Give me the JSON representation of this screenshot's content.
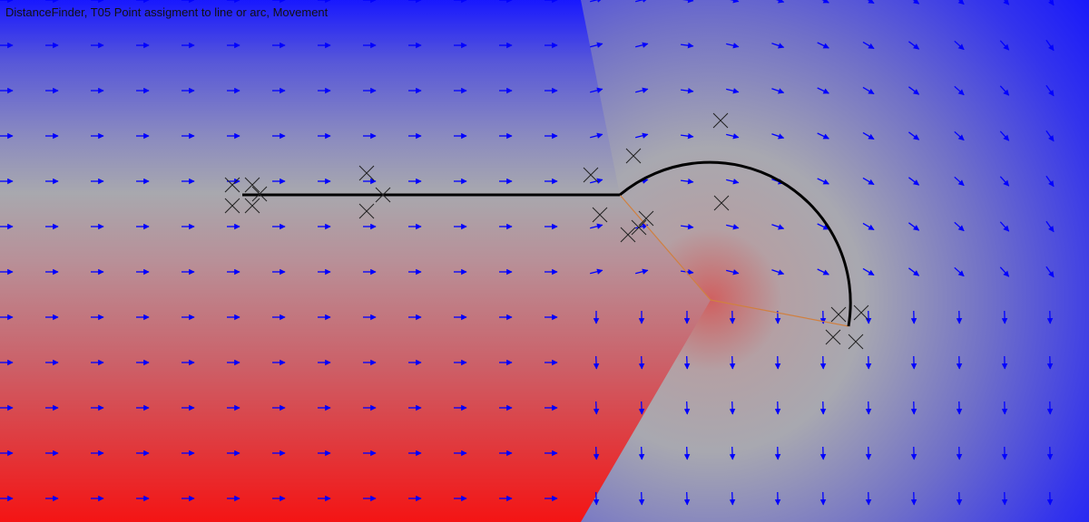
{
  "title": "DistanceFinder, T05 Point assigment to line or arc, Movement",
  "colors": {
    "near_color": "#f01818",
    "mid_color": "#a8a8b0",
    "far_color": "#1010ff",
    "arrow_color": "#0000ff",
    "line_color": "#000000",
    "marker_color": "#222222",
    "guide_color": "#d08040"
  }
}
